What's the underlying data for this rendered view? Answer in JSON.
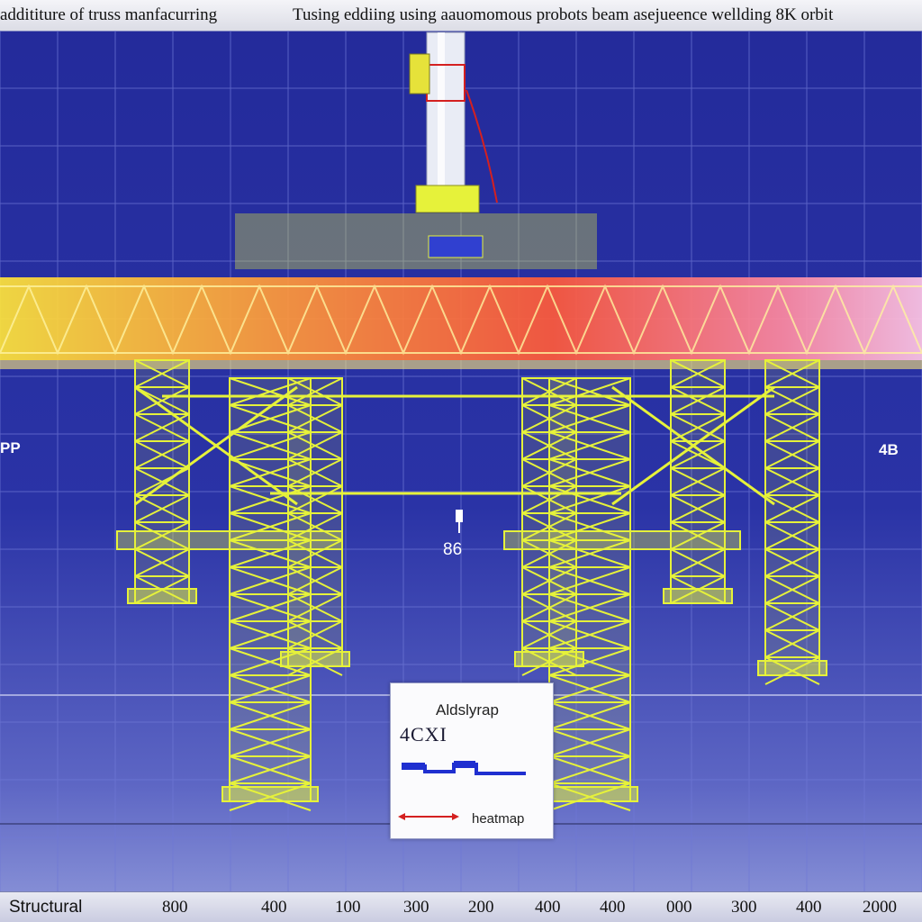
{
  "header": {
    "title_left": "addititure of truss manfacurring",
    "title_right": "Tusing  eddiing  using aauomomous probots   beam asejueence wellding   8K orbit"
  },
  "side_labels": {
    "left": "PP",
    "right": "4B",
    "center": "86"
  },
  "legend": {
    "title": "Aldslyrap",
    "code": "4CXI",
    "heatmap_label": "heatmap",
    "colors": {
      "series": "#1f2fd0",
      "arrow": "#d42020"
    }
  },
  "footer": {
    "label": "Structural",
    "ticks": [
      "800",
      "400",
      "100",
      "300",
      "200",
      "400",
      "400",
      "000",
      "300",
      "400",
      "2000"
    ]
  },
  "colors": {
    "background": "#2a33a6",
    "truss": "#e6f23a",
    "beam_hot": "#ff6a3a",
    "beam_warm": "#ffd23a",
    "beam_cool": "#ffb6d8",
    "grid": "#6f78d6"
  }
}
